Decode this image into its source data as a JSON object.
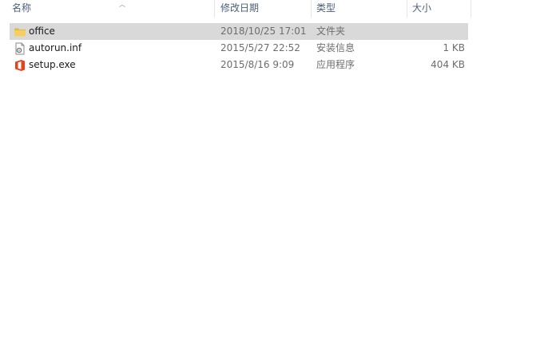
{
  "columns": {
    "name": "名称",
    "date": "修改日期",
    "type": "类型",
    "size": "大小"
  },
  "files": [
    {
      "name": "office",
      "date": "2018/10/25 17:01",
      "type": "文件夹",
      "size": "",
      "icon": "folder-icon",
      "selected": true
    },
    {
      "name": "autorun.inf",
      "date": "2015/5/27 22:52",
      "type": "安装信息",
      "size": "1 KB",
      "icon": "settings-file-icon",
      "selected": false
    },
    {
      "name": "setup.exe",
      "date": "2015/8/16 9:09",
      "type": "应用程序",
      "size": "404 KB",
      "icon": "office-logo-icon",
      "selected": false
    }
  ],
  "colors": {
    "selected_row": "#d9d9d9",
    "header_text": "#4c607a",
    "folder": "#f6cf63",
    "office_logo": "#e6421d"
  }
}
